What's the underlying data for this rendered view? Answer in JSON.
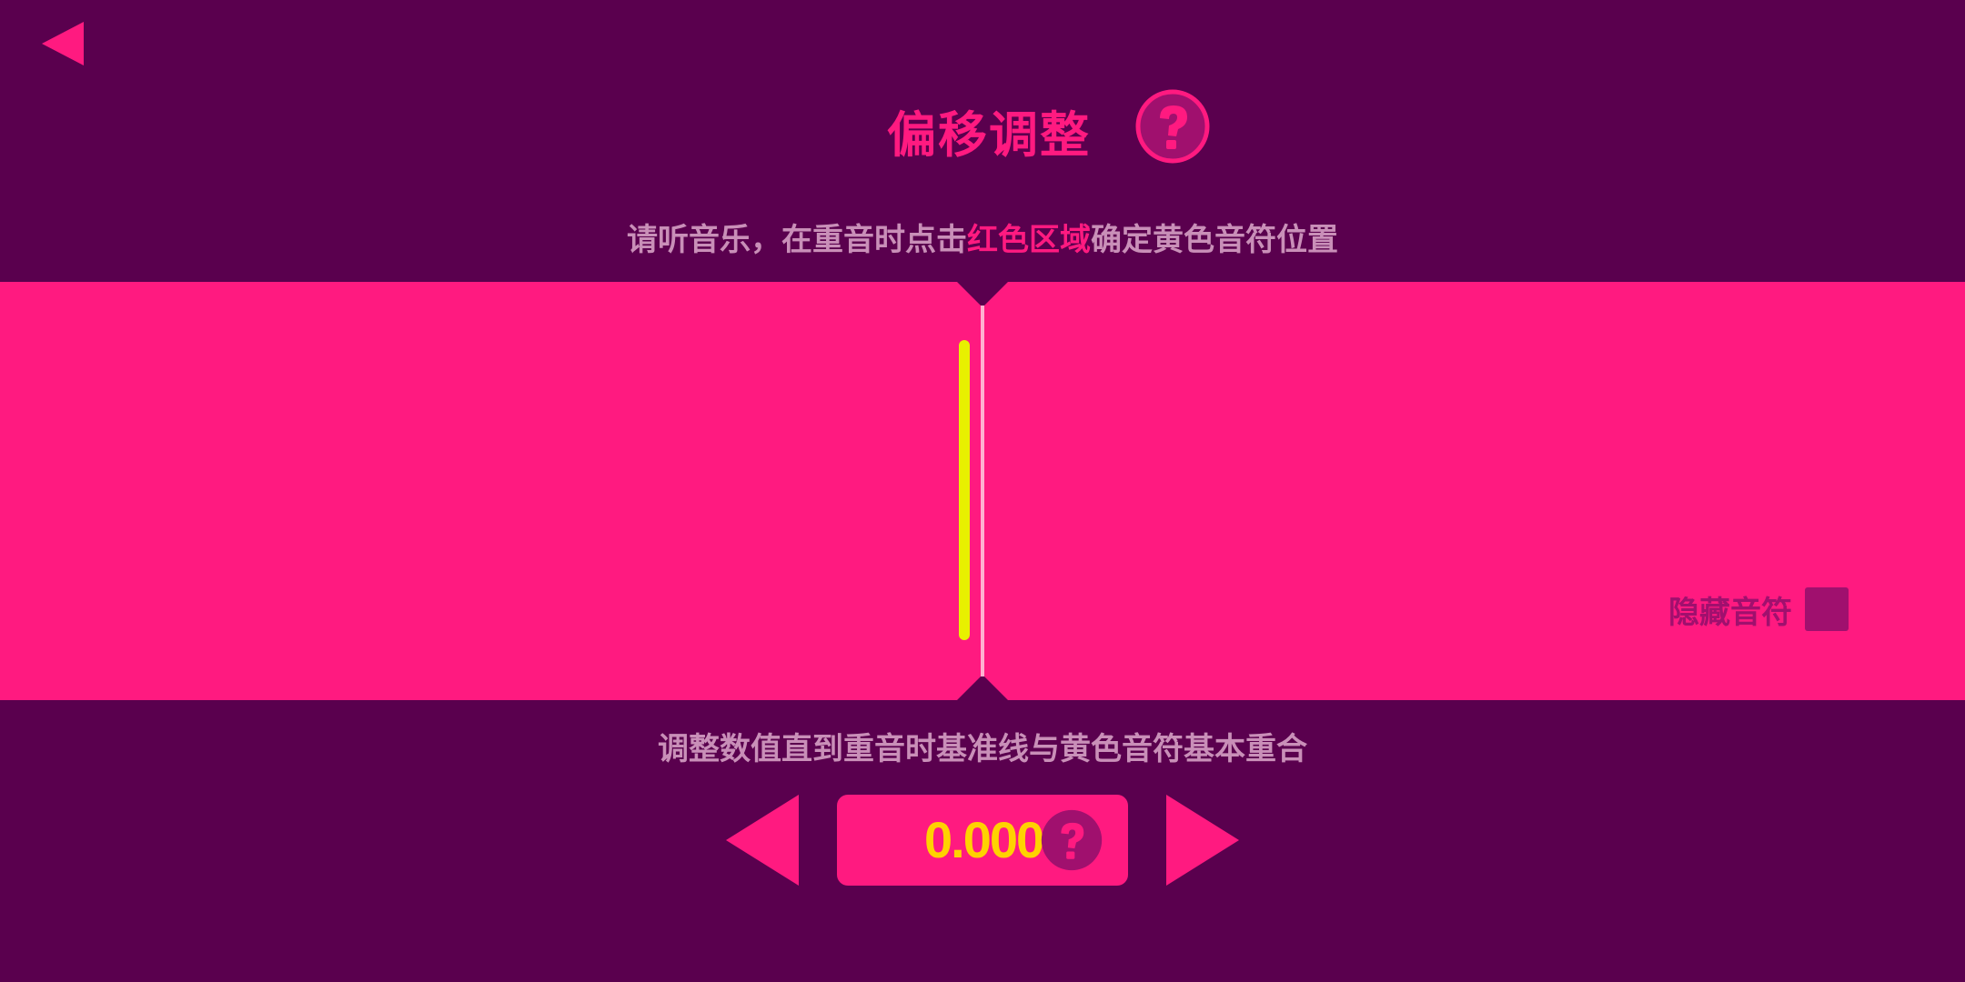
{
  "header": {
    "title": "偏移调整"
  },
  "instruction": {
    "before": "请听音乐，在重音时点击",
    "highlight": "红色区域",
    "after": "确定黄色音符位置"
  },
  "hide_notes": {
    "label": "隐藏音符",
    "checked": false
  },
  "adjust": {
    "hint": "调整数值直到重音时基准线与黄色音符基本重合",
    "value": "0.000"
  },
  "colors": {
    "background": "#5a004e",
    "accent": "#ff1a80",
    "note": "#e8f000",
    "value": "#ffd200",
    "muted_text": "#c98fb8"
  },
  "icons": {
    "back": "back-arrow-icon",
    "help": "question-mark-icon",
    "decrease": "left-triangle-icon",
    "increase": "right-triangle-icon"
  }
}
